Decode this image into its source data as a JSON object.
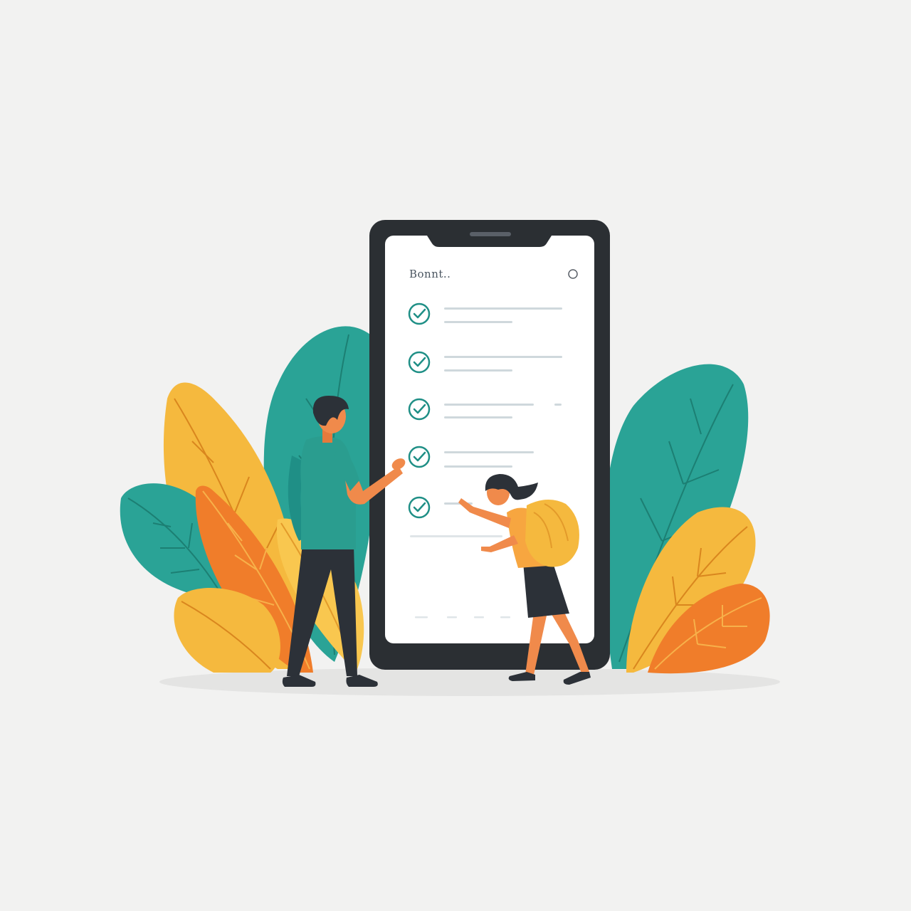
{
  "colors": {
    "background": "#f2f2f1",
    "phone_frame": "#2b2f33",
    "screen": "#ffffff",
    "teal": "#2a9d8f",
    "yellow": "#f4b740",
    "orange": "#f07d2a",
    "dark": "#2c3138",
    "skin": "#f08a4b"
  },
  "phone": {
    "screen_title": "Bonnt..",
    "menu_icon": "circle-icon",
    "checklist": [
      {
        "checked": true
      },
      {
        "checked": true
      },
      {
        "checked": true
      },
      {
        "checked": true
      },
      {
        "checked": true
      }
    ]
  }
}
